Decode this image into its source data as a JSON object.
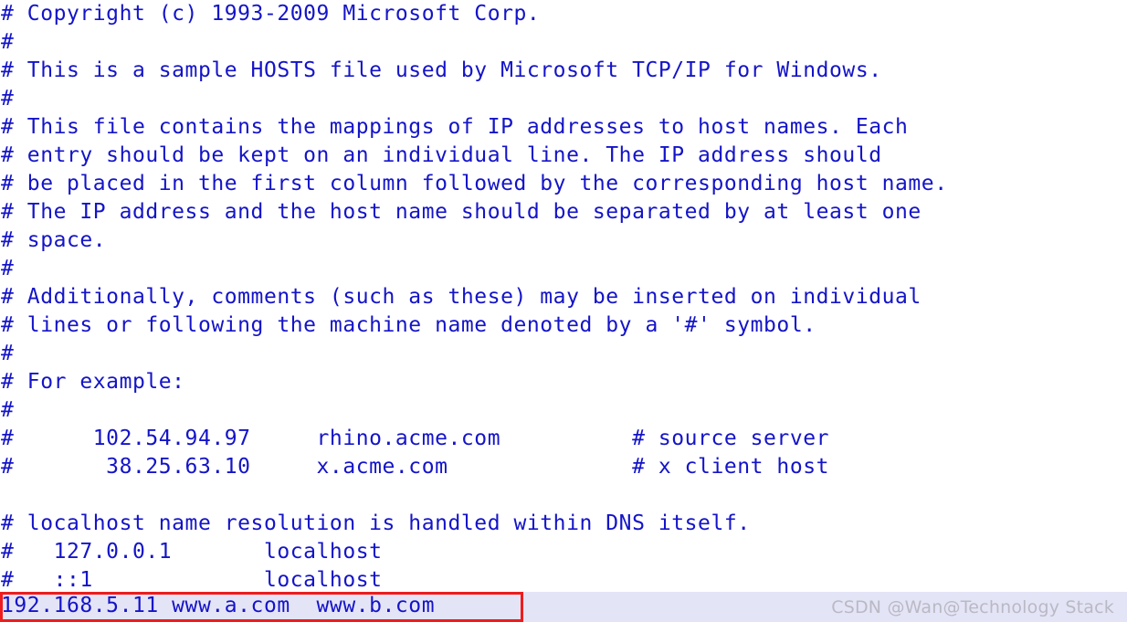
{
  "document": {
    "kind": "hosts-file",
    "text_color": "#1414c8",
    "background_color": "#ffffff",
    "lines": [
      "# Copyright (c) 1993-2009 Microsoft Corp.",
      "#",
      "# This is a sample HOSTS file used by Microsoft TCP/IP for Windows.",
      "#",
      "# This file contains the mappings of IP addresses to host names. Each",
      "# entry should be kept on an individual line. The IP address should",
      "# be placed in the first column followed by the corresponding host name.",
      "# The IP address and the host name should be separated by at least one",
      "# space.",
      "#",
      "# Additionally, comments (such as these) may be inserted on individual",
      "# lines or following the machine name denoted by a '#' symbol.",
      "#",
      "# For example:",
      "#",
      "#      102.54.94.97     rhino.acme.com          # source server",
      "#       38.25.63.10     x.acme.com              # x client host",
      "",
      "# localhost name resolution is handled within DNS itself.",
      "#   127.0.0.1       localhost",
      "#   ::1             localhost"
    ]
  },
  "active_line": {
    "text": "192.168.5.11 www.a.com  www.b.com",
    "highlight_color": "#e4e4f7",
    "annotation_box_color": "#ee1c1c"
  },
  "watermark": {
    "text": "CSDN @Wan@Technology Stack",
    "color": "#b9b9c4"
  }
}
